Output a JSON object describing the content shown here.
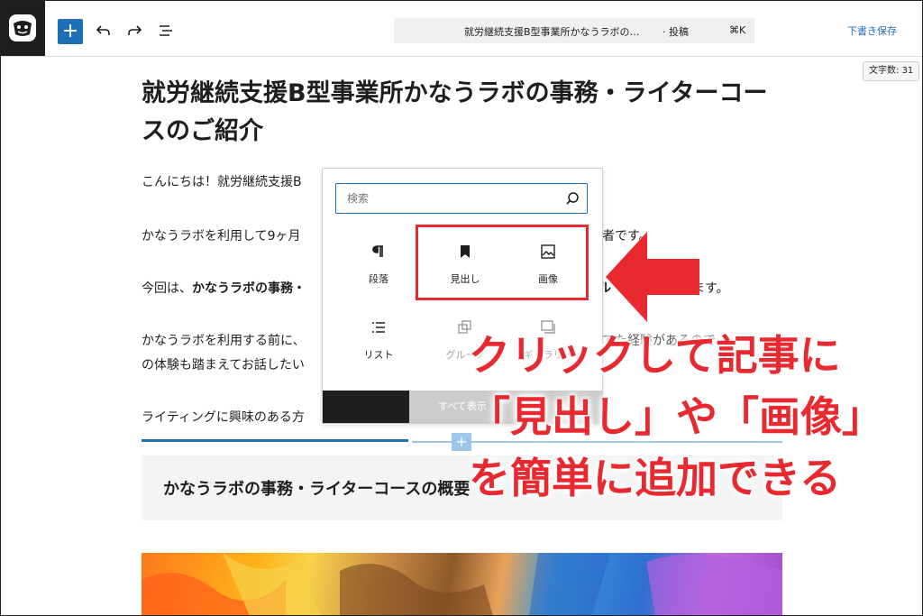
{
  "toolbar": {
    "add_label": "+",
    "command_title": "就労継続支援B型事業所かなうラボの…",
    "command_sep": "· 投稿",
    "command_shortcut": "⌘K",
    "save_draft": "下書き保存",
    "word_count": "文字数: 31",
    "accent_color": "#1d6fb8"
  },
  "post": {
    "title": "就労継続支援B型事業所かなうラボの事務・ライターコースのご紹介",
    "paragraphs": {
      "p1": "こんにちは！就労継続支援B",
      "p2a": "かなうラボを利用して9ヶ月",
      "p2b": "者です。",
      "p3a": "今回は、",
      "p3b": "かなうラボの事務・",
      "p3c": "ル",
      "p3d": "ます。",
      "p4a": "かなうラボを利用する前に、",
      "p4b": "てた経験があるので、",
      "p5a": "の体験も踏まえてお話したい",
      "p6": "ライティングに興味のある方"
    },
    "heading2": "かなうラボの事務・ライターコースの概要",
    "heading2_visible": "かなうラボの事務・ライターコースの概要"
  },
  "inserter": {
    "search_placeholder": "検索",
    "blocks": [
      {
        "label": "段落",
        "icon": "paragraph-icon"
      },
      {
        "label": "見出し",
        "icon": "bookmark-icon"
      },
      {
        "label": "画像",
        "icon": "image-icon"
      },
      {
        "label": "リスト",
        "icon": "list-icon"
      },
      {
        "label": "グループ",
        "icon": "group-icon"
      },
      {
        "label": "ギャラリー",
        "icon": "gallery-icon"
      }
    ],
    "show_all": "すべて表示"
  },
  "annotation": {
    "line1": "クリックして記事に",
    "line2": "「見出し」や「画像」",
    "line3": "を簡単に追加できる",
    "color": "#e8292f"
  }
}
